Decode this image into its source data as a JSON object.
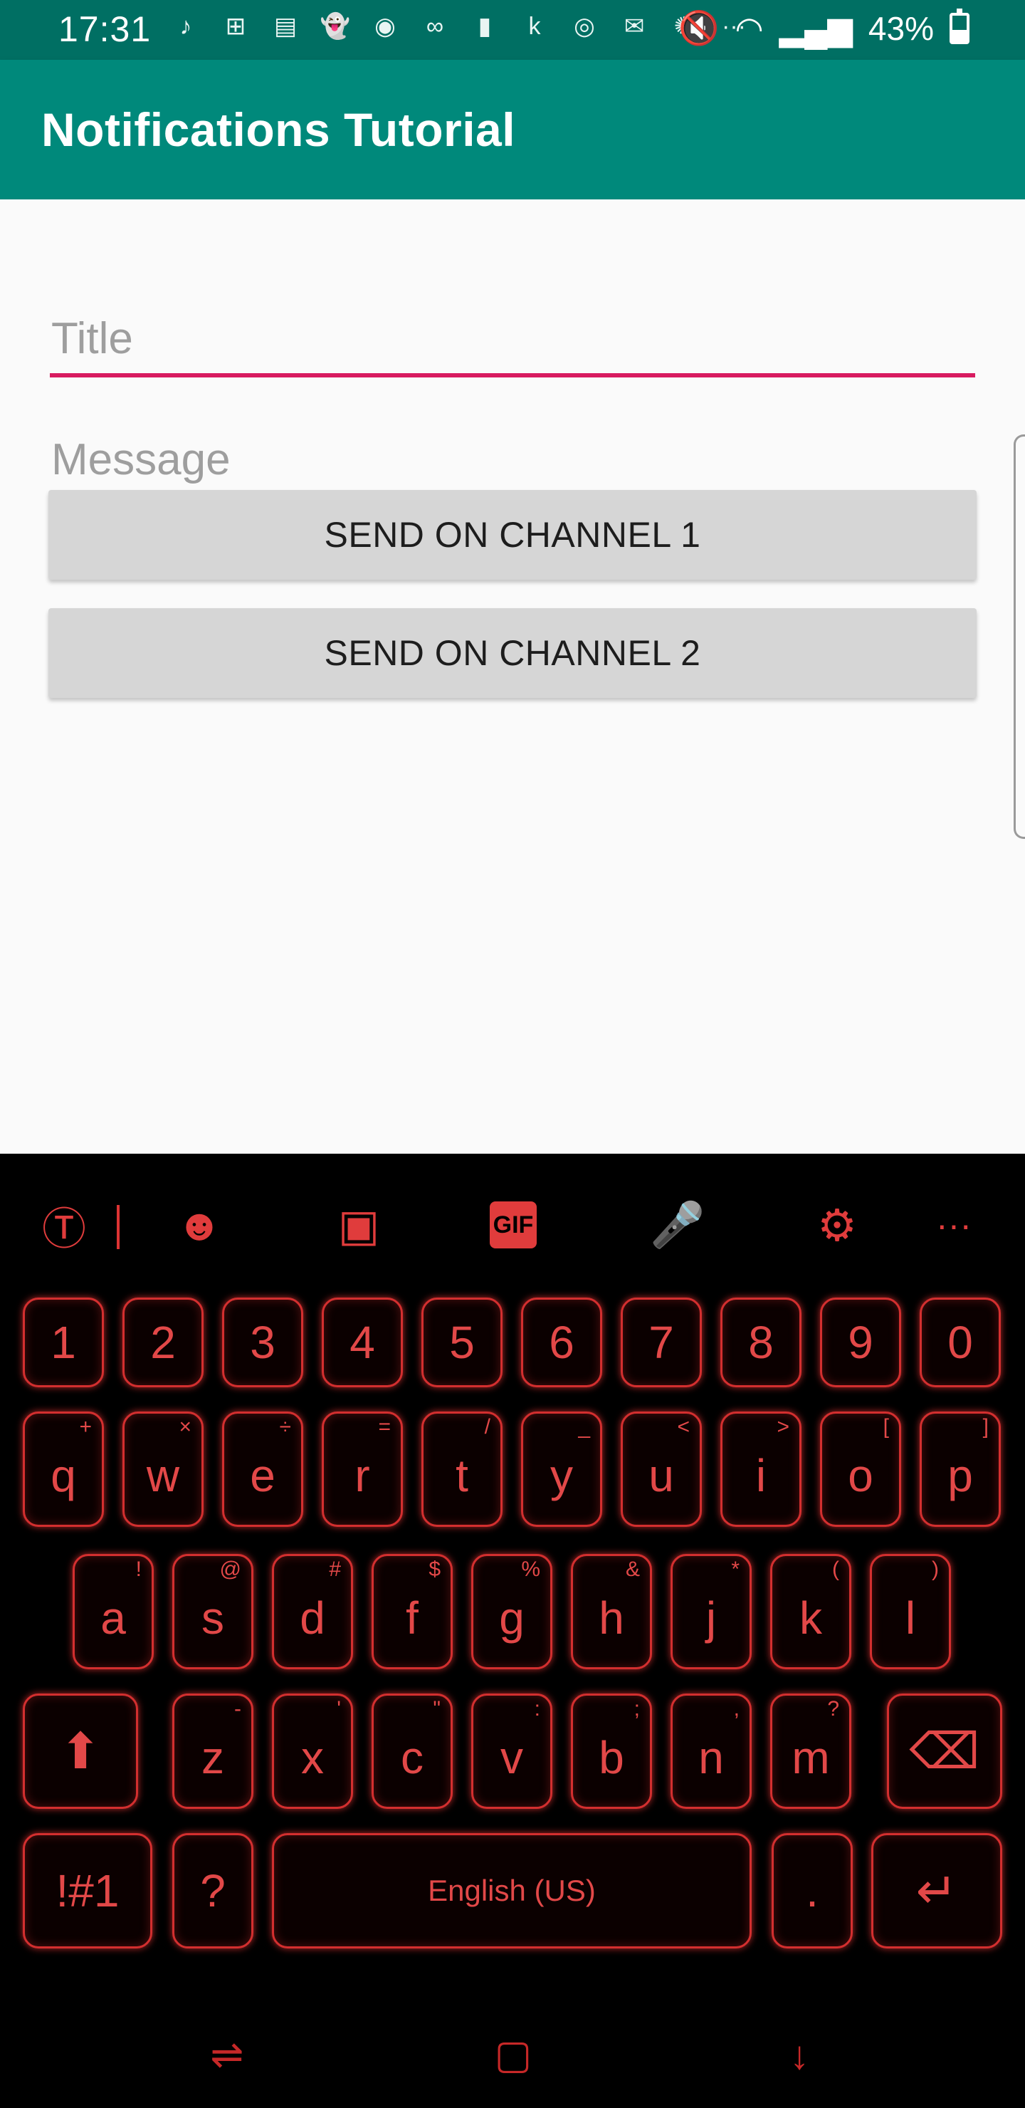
{
  "status_bar": {
    "time": "17:31",
    "battery": "43%",
    "notification_icons": [
      "music-note-icon",
      "cards-icon",
      "image-icon",
      "ghost-icon",
      "line-icon",
      "voicemail-icon",
      "square-icon",
      "kik-icon",
      "instagram-icon",
      "email-icon",
      "fan-icon",
      "more-dots-icon"
    ],
    "notification_glyphs": [
      "♪",
      "⊞",
      "▤",
      "👻",
      "◉",
      "∞",
      "▮",
      "k",
      "◎",
      "✉",
      "✺",
      "···"
    ]
  },
  "app_bar": {
    "title": "Notifications Tutorial"
  },
  "form": {
    "title_placeholder": "Title",
    "message_placeholder": "Message",
    "channel1_label": "SEND ON CHANNEL 1",
    "channel2_label": "SEND ON CHANNEL 2"
  },
  "keyboard": {
    "accent_color": "#d32f2f",
    "toolbar": {
      "translate": "Ⓣ",
      "emoji": "☻",
      "sticker": "▣",
      "gif": "GIF",
      "mic": "🎤",
      "settings": "⚙",
      "more": "···"
    },
    "number_row": [
      "1",
      "2",
      "3",
      "4",
      "5",
      "6",
      "7",
      "8",
      "9",
      "0"
    ],
    "row1": [
      {
        "k": "q",
        "s": "+"
      },
      {
        "k": "w",
        "s": "×"
      },
      {
        "k": "e",
        "s": "÷"
      },
      {
        "k": "r",
        "s": "="
      },
      {
        "k": "t",
        "s": "/"
      },
      {
        "k": "y",
        "s": "_"
      },
      {
        "k": "u",
        "s": "<"
      },
      {
        "k": "i",
        "s": ">"
      },
      {
        "k": "o",
        "s": "["
      },
      {
        "k": "p",
        "s": "]"
      }
    ],
    "row2": [
      {
        "k": "a",
        "s": "!"
      },
      {
        "k": "s",
        "s": "@"
      },
      {
        "k": "d",
        "s": "#"
      },
      {
        "k": "f",
        "s": "$"
      },
      {
        "k": "g",
        "s": "%"
      },
      {
        "k": "h",
        "s": "&"
      },
      {
        "k": "j",
        "s": "*"
      },
      {
        "k": "k",
        "s": "("
      },
      {
        "k": "l",
        "s": ")"
      }
    ],
    "row3": [
      {
        "k": "z",
        "s": "-"
      },
      {
        "k": "x",
        "s": "'"
      },
      {
        "k": "c",
        "s": "\""
      },
      {
        "k": "v",
        "s": ":"
      },
      {
        "k": "b",
        "s": ";"
      },
      {
        "k": "n",
        "s": ","
      },
      {
        "k": "m",
        "s": "?"
      }
    ],
    "shift": "⬆",
    "backspace": "⌫",
    "symbols_key": "!#1",
    "question_key": "?",
    "space_label": "English (US)",
    "period_key": ".",
    "enter": "↵"
  },
  "nav_bar": {
    "recents": "⇌",
    "home": "▢",
    "back": "↓"
  }
}
